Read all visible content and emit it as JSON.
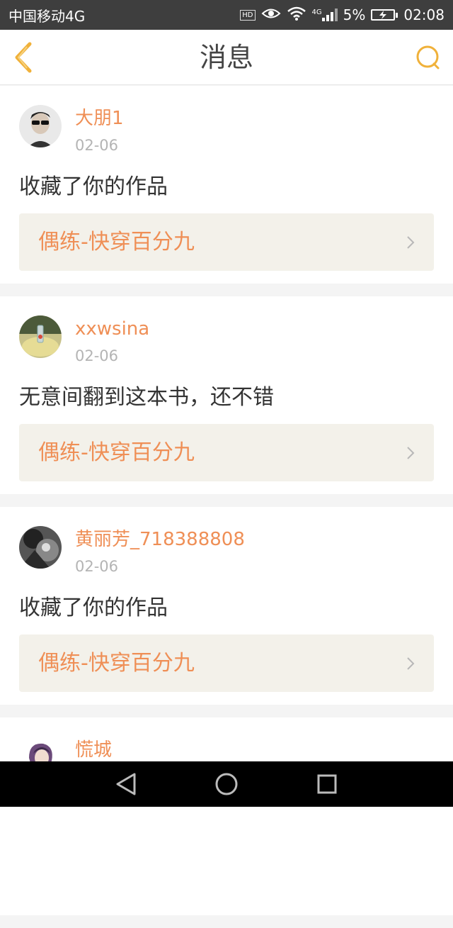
{
  "status_bar": {
    "carrier": "中国移动4G",
    "hd_badge": "HD",
    "network_label": "4G",
    "battery_percent": "5%",
    "time": "02:08",
    "icons": [
      "eye-icon",
      "wifi-icon",
      "signal-icon",
      "battery-charging-icon"
    ]
  },
  "header": {
    "title": "消息",
    "back_icon": "chevron-left-icon",
    "search_icon": "search-icon",
    "accent_color": "#f0b13a"
  },
  "messages": [
    {
      "username": "大朋1",
      "date": "02-06",
      "comment": "收藏了你的作品",
      "book_title": "偶练-快穿百分九"
    },
    {
      "username": "xxwsina",
      "date": "02-06",
      "comment": "无意间翻到这本书，还不错",
      "book_title": "偶练-快穿百分九"
    },
    {
      "username": "黄丽芳_718388808",
      "date": "02-06",
      "comment": "收藏了你的作品",
      "book_title": "偶练-快穿百分九"
    },
    {
      "username": "慌城"
    }
  ],
  "nav_bar": {
    "icons": [
      "back-triangle-icon",
      "home-circle-icon",
      "recents-square-icon"
    ]
  },
  "colors": {
    "name_orange": "#ef8f56",
    "book_bg": "#f3f1ea",
    "status_bar_bg": "#3e3e3e"
  }
}
